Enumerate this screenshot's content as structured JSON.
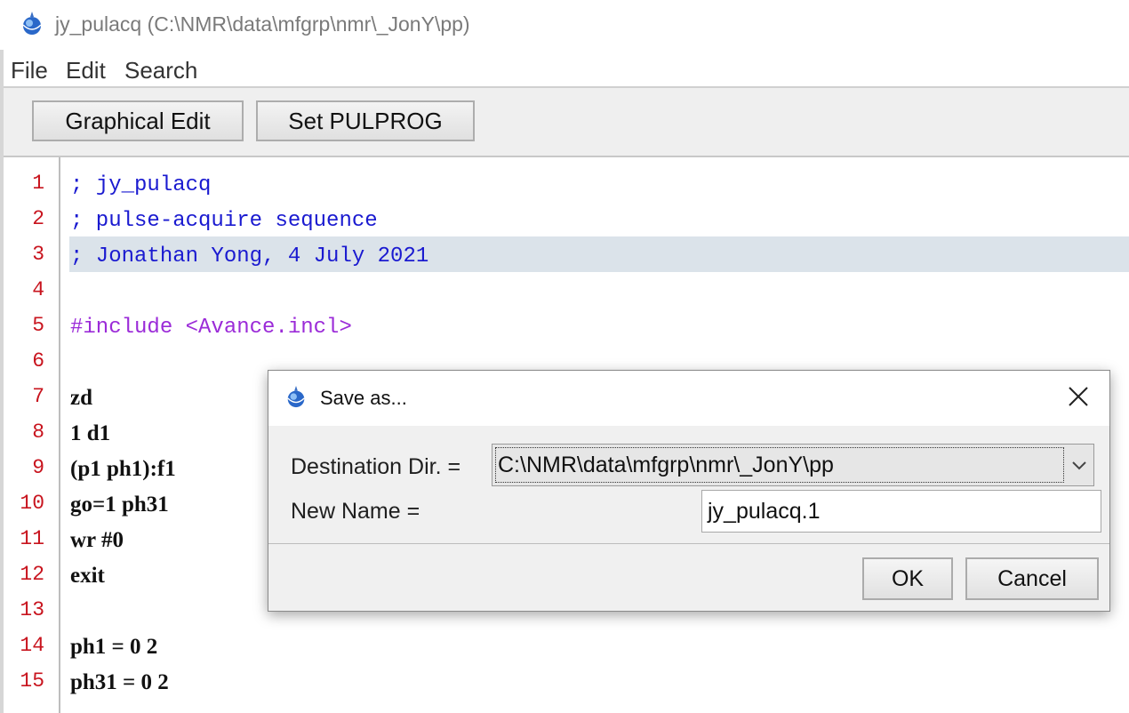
{
  "window": {
    "title": "jy_pulacq (C:\\NMR\\data\\mfgrp\\nmr\\_JonY\\pp)"
  },
  "menu": {
    "file": "File",
    "edit": "Edit",
    "search": "Search"
  },
  "toolbar": {
    "graphical_edit": "Graphical Edit",
    "set_pulprog": "Set PULPROG"
  },
  "editor": {
    "line_numbers": [
      "1",
      "2",
      "3",
      "4",
      "5",
      "6",
      "7",
      "8",
      "9",
      "10",
      "11",
      "12",
      "13",
      "14",
      "15"
    ],
    "lines": [
      "; jy_pulacq",
      "; pulse-acquire sequence",
      "; Jonathan Yong, 4 July 2021",
      "",
      "#include <Avance.incl>",
      "",
      "zd",
      "1 d1",
      "(p1 ph1):f1",
      "go=1 ph31",
      "wr #0",
      "exit",
      "",
      "ph1 = 0 2",
      "ph31 = 0 2"
    ]
  },
  "dialog": {
    "title": "Save as...",
    "dest_label": "Destination Dir. =",
    "dest_value": "C:\\NMR\\data\\mfgrp\\nmr\\_JonY\\pp",
    "name_label": "New Name =",
    "name_value": "jy_pulacq.1",
    "ok": "OK",
    "cancel": "Cancel"
  },
  "colors": {
    "comment": "#1a1ad0",
    "directive": "#9b2bd8",
    "line_number": "#c8141e",
    "highlight": "#dbe3ea"
  }
}
